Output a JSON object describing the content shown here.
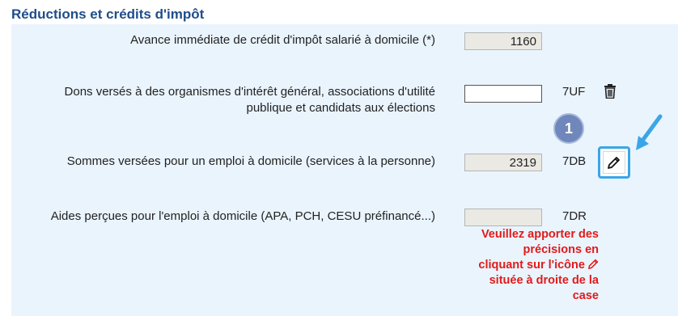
{
  "section": {
    "title": "Réductions et crédits d'impôt"
  },
  "rows": [
    {
      "label": "Avance immédiate de crédit d'impôt salarié à domicile (*)",
      "value": "1160",
      "code": ""
    },
    {
      "label_line1": "Dons versés à des organismes d'intérêt général, associations d'utilité",
      "label_line2": "publique et candidats aux élections",
      "value": "",
      "code": "7UF"
    },
    {
      "label": "Sommes versées pour un emploi à domicile (services à la personne)",
      "value": "2319",
      "code": "7DB"
    },
    {
      "label": "Aides perçues pour l'emploi à domicile (APA, PCH, CESU préfinancé...)",
      "value": "",
      "code": "7DR"
    }
  ],
  "annotation": {
    "step_number": "1",
    "highlight_color": "#3aa6e8"
  },
  "warning": {
    "line1": "Veuillez apporter des",
    "line2": "précisions en",
    "line3": "cliquant sur l'icône",
    "line4": "située à droite de la",
    "line5": "case",
    "color": "#e01b1b"
  },
  "icons": {
    "delete": "trash-icon",
    "edit": "pencil-icon"
  }
}
